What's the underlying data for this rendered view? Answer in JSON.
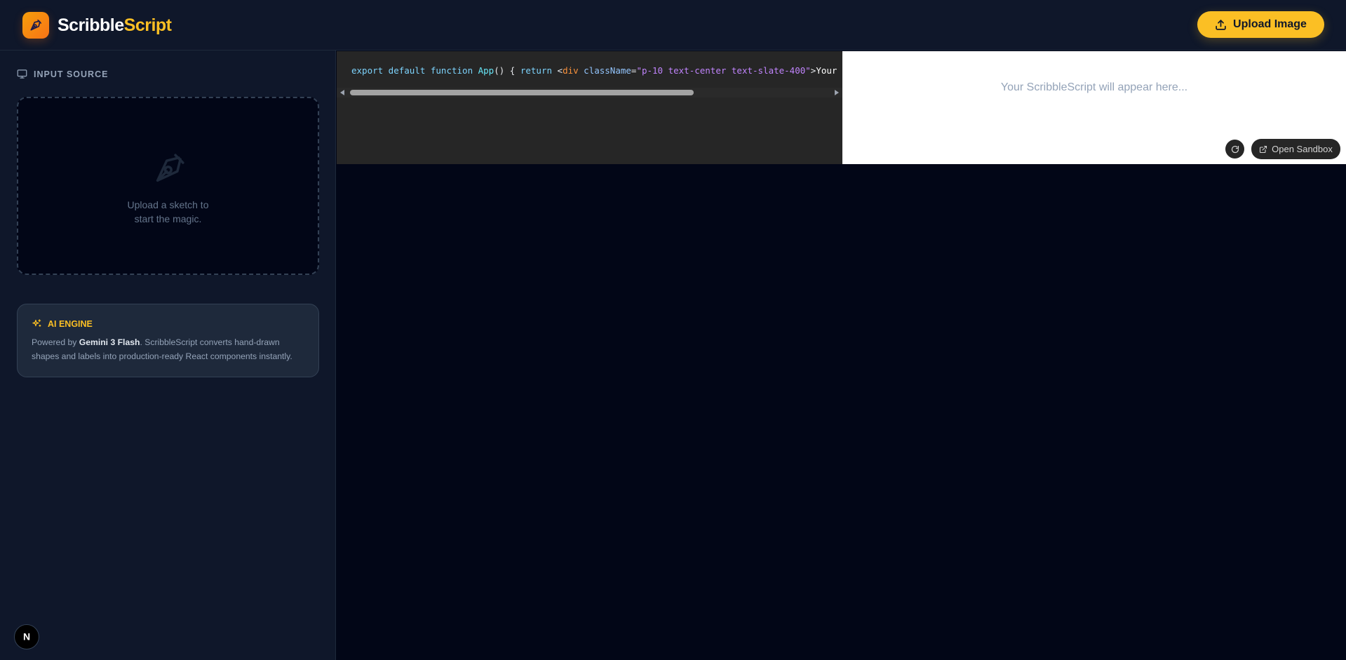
{
  "header": {
    "brand_part1": "Scribble",
    "brand_part2": "Script",
    "upload_button": "Upload Image",
    "logo_icon": "pen-nib-icon",
    "upload_icon": "upload-icon"
  },
  "sidebar": {
    "section_label": "INPUT SOURCE",
    "section_icon": "monitor-icon",
    "dropzone": {
      "icon": "pen-nib-icon",
      "line1": "Upload a sketch to",
      "line2": "start the magic."
    },
    "engine": {
      "icon": "sparkles-icon",
      "title": "AI ENGINE",
      "desc_prefix": "Powered by ",
      "desc_model": "Gemini 3 Flash",
      "desc_rest": ". ScribbleScript converts hand-drawn shapes and labels into production-ready React components instantly."
    },
    "badge_letter": "N"
  },
  "code": {
    "t1": "export default function ",
    "t2": "App",
    "t3": "() { ",
    "t4": "return ",
    "t5": "<",
    "t6": "div",
    "t7": " className",
    "t8": "=",
    "t9": "\"p-10 text-center text-slate-400\"",
    "t10": ">",
    "t11": "Your ScribbleScript will appear here..."
  },
  "preview": {
    "placeholder": "Your ScribbleScript will appear here...",
    "open_sandbox": "Open Sandbox",
    "refresh_icon": "refresh-icon",
    "external_icon": "external-link-icon"
  },
  "colors": {
    "accent": "#fbbf24",
    "background": "#020617",
    "panel": "#0f172a"
  }
}
